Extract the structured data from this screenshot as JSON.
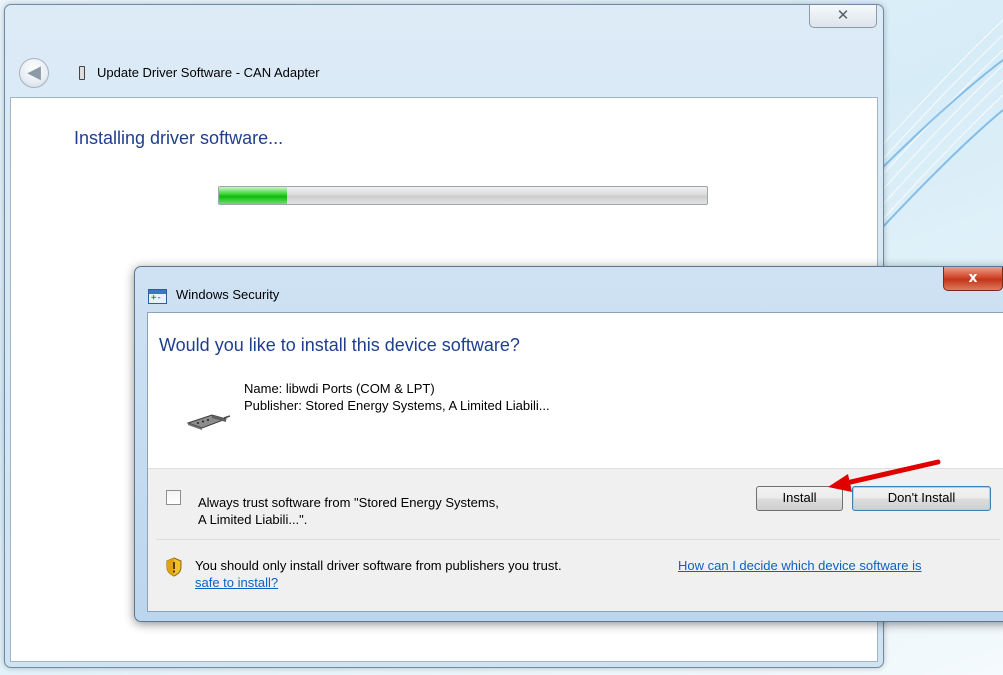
{
  "wizard": {
    "close_glyph": "✕",
    "back_glyph": "◀",
    "title": "Update Driver Software - CAN Adapter",
    "heading": "Installing driver software...",
    "progress_fraction": 0.14
  },
  "security_dialog": {
    "title": "Windows Security",
    "close_glyph": "x",
    "question": "Would you like to install this device software?",
    "name_line": "Name: libwdi Ports (COM & LPT)",
    "publisher_line": "Publisher: Stored Energy Systems, A Limited Liabili...",
    "trust_line1": "Always trust software from \"Stored Energy Systems,",
    "trust_line2": "A Limited Liabili...\".",
    "install_label": "Install",
    "dont_install_label": "Don't Install",
    "warning_text": "You should only install driver software from publishers you trust.",
    "help_link_line1": "How can I decide which device software is",
    "help_link_line2": "safe to install?",
    "icons": {
      "dialog": "windows-security-icon",
      "device": "serial-port-icon",
      "warning": "shield-warning-icon"
    }
  },
  "colors": {
    "heading_blue": "#1e3f8e",
    "link_blue": "#0a62c4",
    "progress_green": "#0fba0c",
    "close_red": "#c2361b",
    "arrow_red": "#e00000"
  }
}
